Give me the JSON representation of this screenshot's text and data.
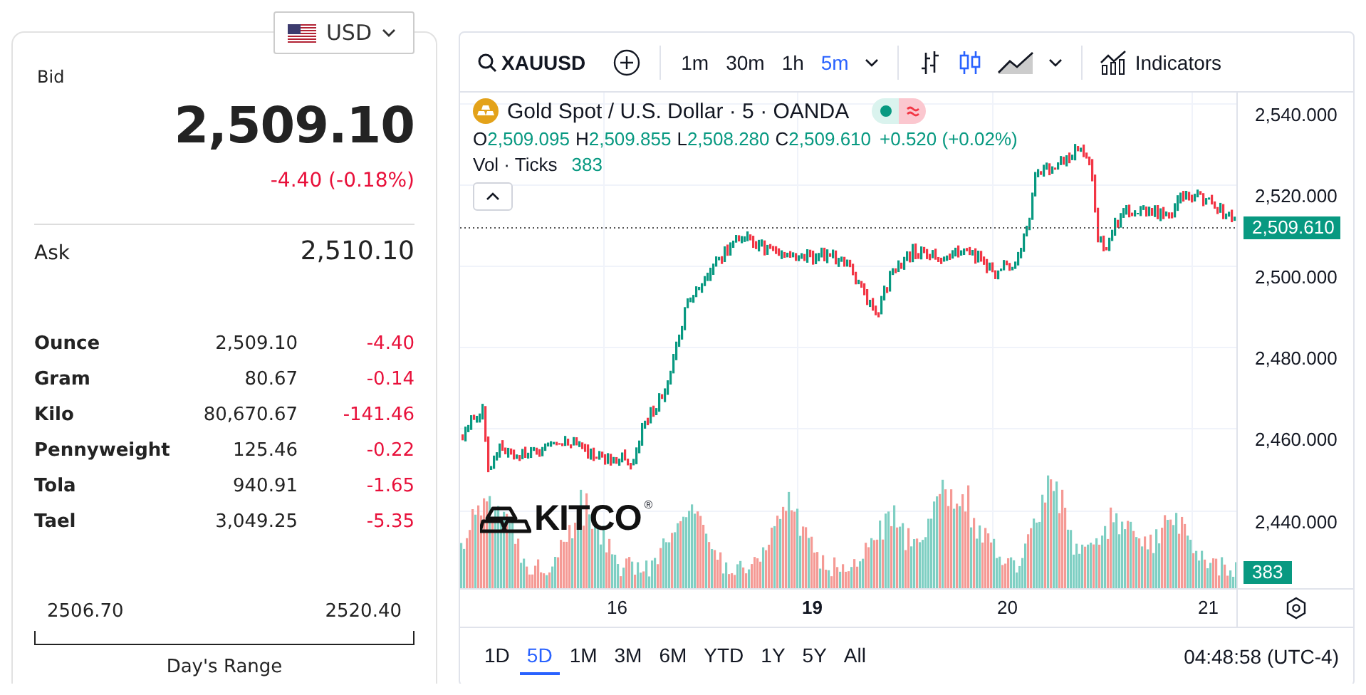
{
  "currency": {
    "label": "USD"
  },
  "quote": {
    "bid_label": "Bid",
    "bid": "2,509.10",
    "change": "-4.40 (-0.18%)",
    "ask_label": "Ask",
    "ask": "2,510.10"
  },
  "units": [
    {
      "name": "Ounce",
      "price": "2,509.10",
      "change": "-4.40"
    },
    {
      "name": "Gram",
      "price": "80.67",
      "change": "-0.14"
    },
    {
      "name": "Kilo",
      "price": "80,670.67",
      "change": "-141.46"
    },
    {
      "name": "Pennyweight",
      "price": "125.46",
      "change": "-0.22"
    },
    {
      "name": "Tola",
      "price": "940.91",
      "change": "-1.65"
    },
    {
      "name": "Tael",
      "price": "3,049.25",
      "change": "-5.35"
    }
  ],
  "days_range": {
    "low": "2506.70",
    "high": "2520.40",
    "label": "Day's Range"
  },
  "chart": {
    "symbol": "XAUUSD",
    "intervals": [
      {
        "label": "1m",
        "selected": false
      },
      {
        "label": "30m",
        "selected": false
      },
      {
        "label": "1h",
        "selected": false
      },
      {
        "label": "5m",
        "selected": true
      }
    ],
    "chart_types": [
      {
        "kind": "bars",
        "selected": false
      },
      {
        "kind": "candles",
        "selected": true
      },
      {
        "kind": "area",
        "selected": false
      }
    ],
    "indicators": "Indicators",
    "legend": {
      "title": "Gold Spot / U.S. Dollar · 5 · OANDA",
      "ohlc": [
        {
          "key": "O",
          "value": "2,509.095"
        },
        {
          "key": "H",
          "value": "2,509.855"
        },
        {
          "key": "L",
          "value": "2,508.280"
        },
        {
          "key": "C",
          "value": "2,509.610"
        }
      ],
      "change": "+0.520 (+0.02%)",
      "volume_label": "Vol · Ticks",
      "volume": "383"
    },
    "logo": {
      "text": "KITCO",
      "mark": "®"
    },
    "price_ticks": [
      "2,540.000",
      "2,520.000",
      "2,500.000",
      "2,480.000",
      "2,460.000",
      "2,440.000"
    ],
    "last_price": "2,509.610",
    "volume_badge": "383",
    "time_labels": [
      {
        "label": "16",
        "emphasized": false
      },
      {
        "label": "19",
        "emphasized": true
      },
      {
        "label": "20",
        "emphasized": false
      },
      {
        "label": "21",
        "emphasized": false
      }
    ],
    "ranges": [
      {
        "label": "1D",
        "selected": false
      },
      {
        "label": "5D",
        "selected": true
      },
      {
        "label": "1M",
        "selected": false
      },
      {
        "label": "3M",
        "selected": false
      },
      {
        "label": "6M",
        "selected": false
      },
      {
        "label": "YTD",
        "selected": false
      },
      {
        "label": "1Y",
        "selected": false
      },
      {
        "label": "5Y",
        "selected": false
      },
      {
        "label": "All",
        "selected": false
      }
    ],
    "clock": "04:48:58 (UTC-4)"
  }
}
